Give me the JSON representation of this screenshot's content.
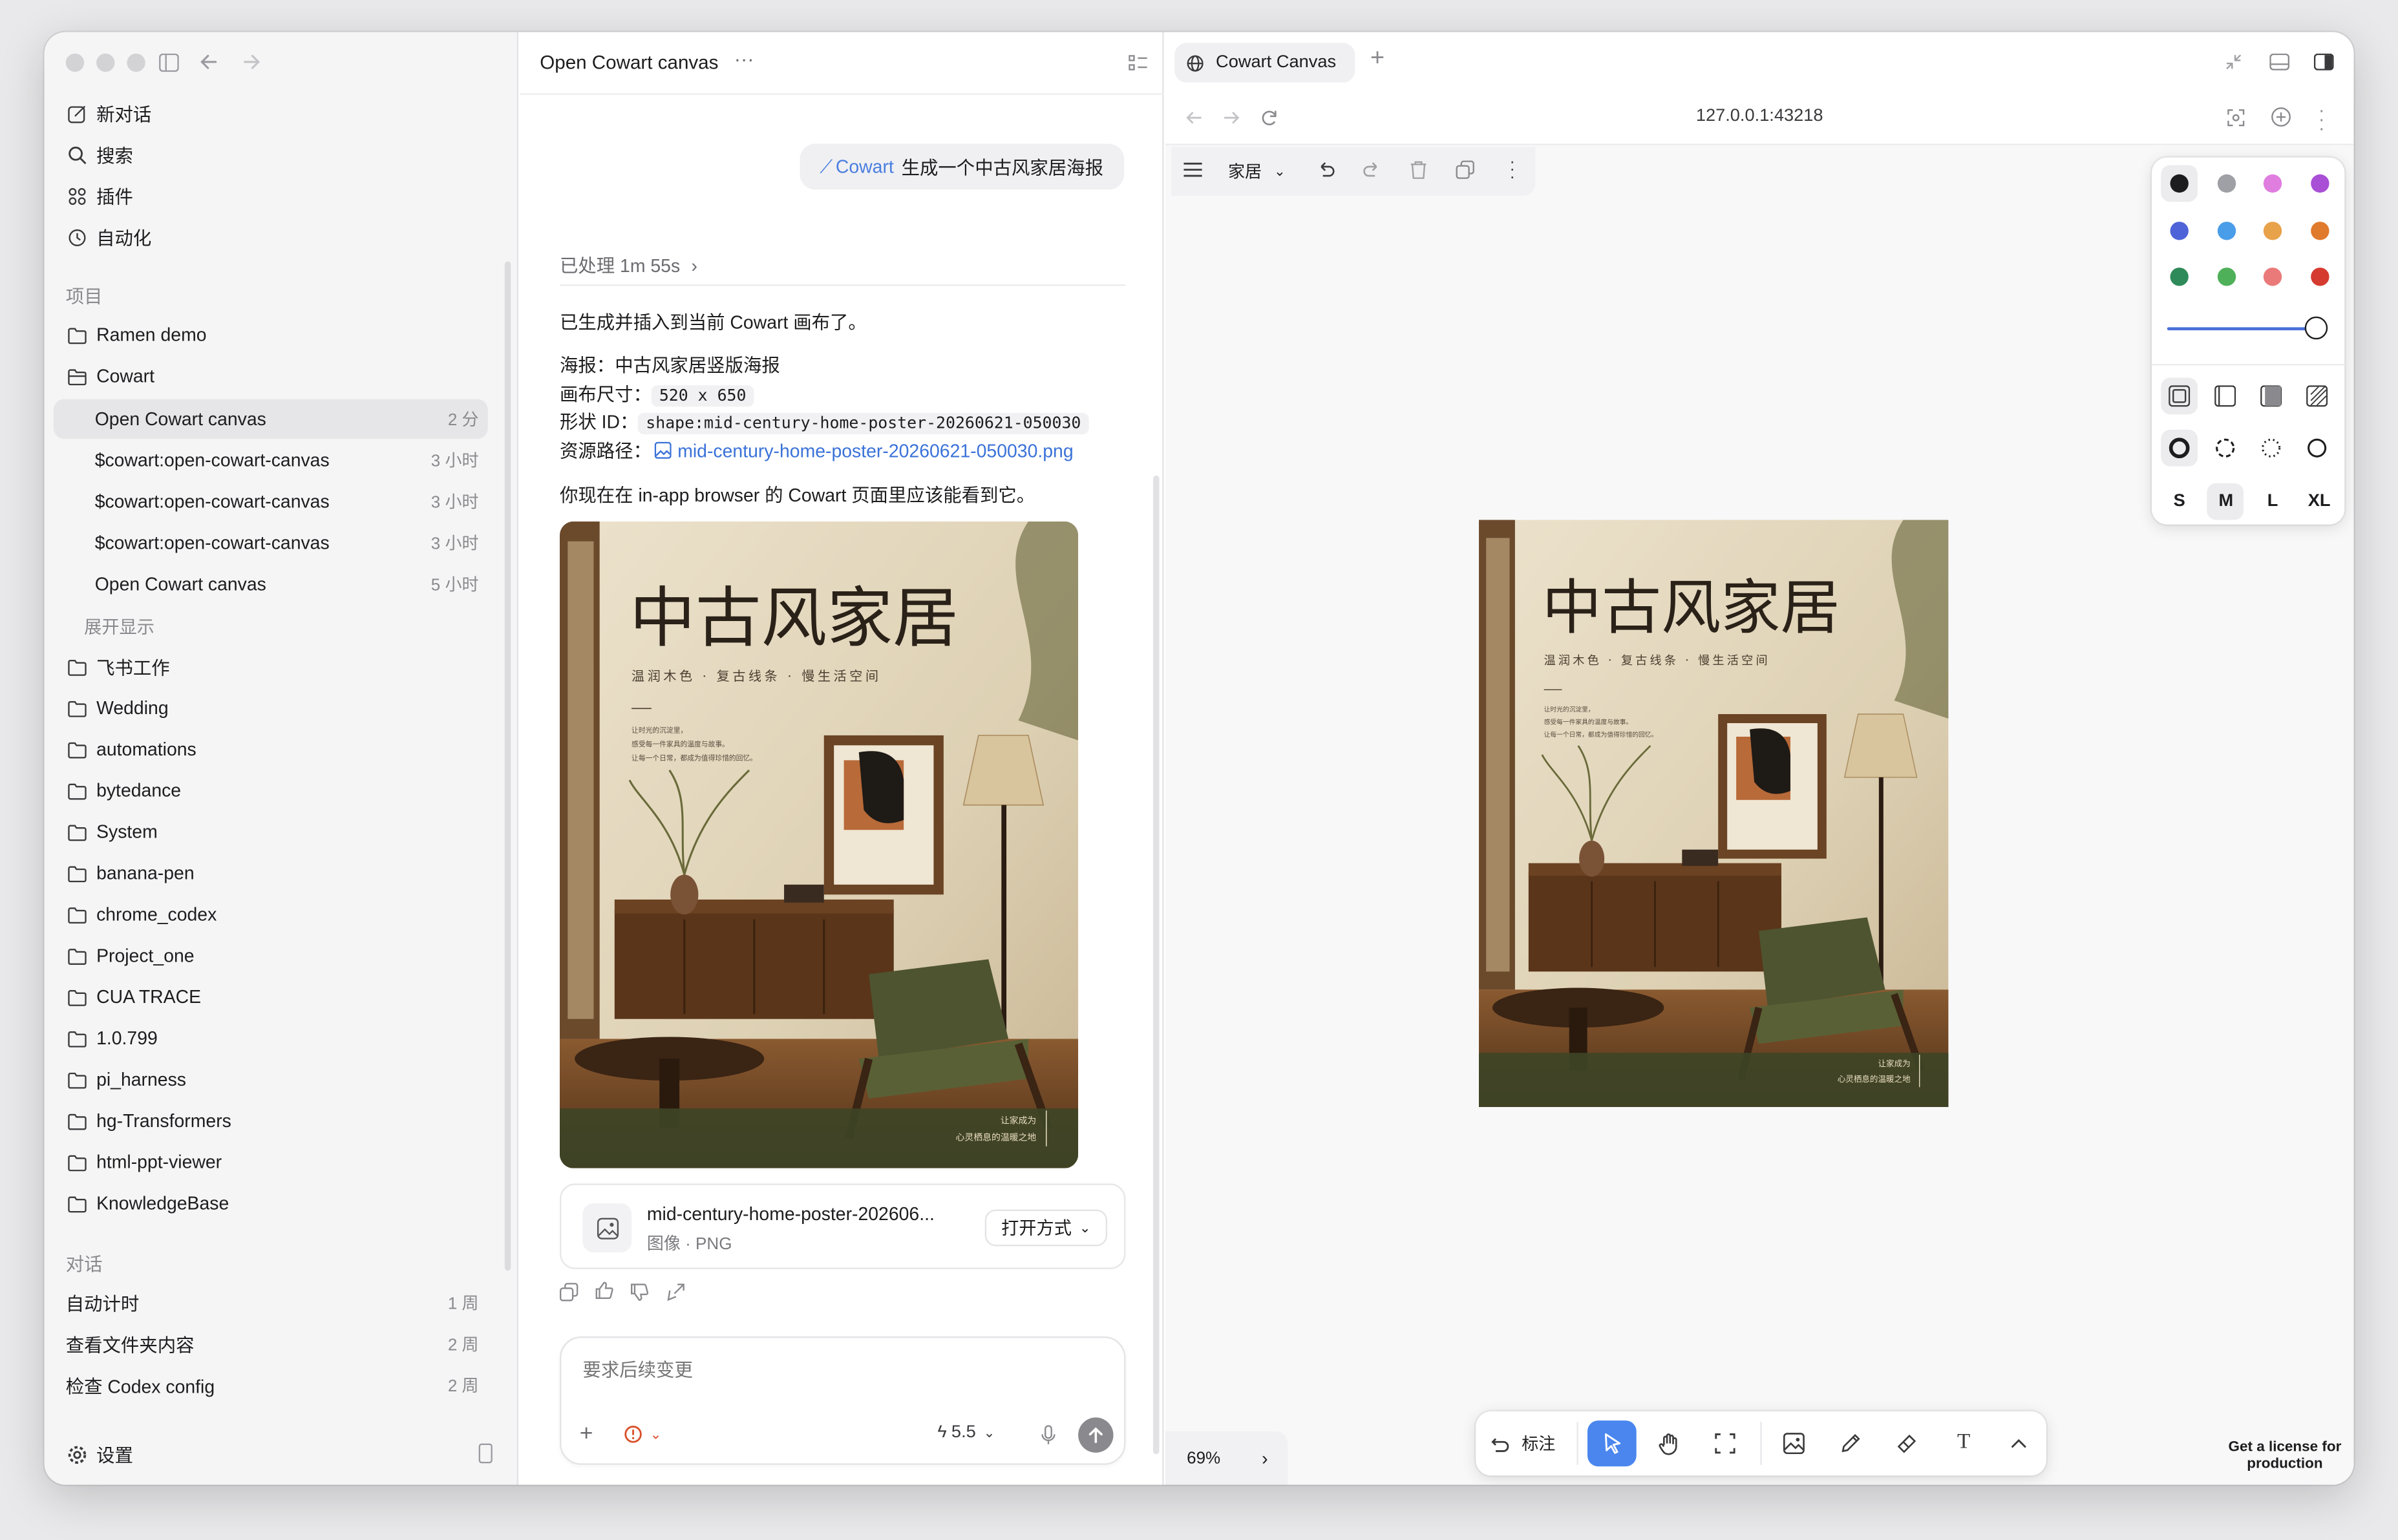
{
  "sidebar": {
    "top_items": [
      {
        "label": "新对话",
        "icon": "new-chat-icon"
      },
      {
        "label": "搜索",
        "icon": "search-icon"
      },
      {
        "label": "插件",
        "icon": "plugin-icon"
      },
      {
        "label": "自动化",
        "icon": "automation-icon"
      }
    ],
    "projects_title": "项目",
    "projects_top": [
      {
        "label": "Ramen demo"
      },
      {
        "label": "Cowart"
      }
    ],
    "cowart_threads": [
      {
        "label": "Open Cowart canvas",
        "time": "2 分"
      },
      {
        "label": "$cowart:open-cowart-canvas",
        "time": "3 小时"
      },
      {
        "label": "$cowart:open-cowart-canvas",
        "time": "3 小时"
      },
      {
        "label": "$cowart:open-cowart-canvas",
        "time": "3 小时"
      },
      {
        "label": "Open Cowart canvas",
        "time": "5 小时"
      }
    ],
    "expand_label": "展开显示",
    "projects_rest": [
      {
        "label": "飞书工作"
      },
      {
        "label": "Wedding"
      },
      {
        "label": "automations"
      },
      {
        "label": "bytedance"
      },
      {
        "label": "System"
      },
      {
        "label": "banana-pen"
      },
      {
        "label": "chrome_codex"
      },
      {
        "label": "Project_one"
      },
      {
        "label": "CUA TRACE"
      },
      {
        "label": "1.0.799"
      },
      {
        "label": "pi_harness"
      },
      {
        "label": "hg-Transformers"
      },
      {
        "label": "html-ppt-viewer"
      },
      {
        "label": "KnowledgeBase"
      }
    ],
    "chats_title": "对话",
    "chats": [
      {
        "label": "自动计时",
        "time": "1 周"
      },
      {
        "label": "查看文件夹内容",
        "time": "2 周"
      },
      {
        "label": "检查 Codex config",
        "time": "2 周"
      }
    ],
    "settings_label": "设置"
  },
  "chat": {
    "title": "Open Cowart canvas",
    "user_msg_tag": "Cowart",
    "user_msg": "生成一个中古风家居海报",
    "processed": "已处理 1m 55s",
    "reply_line1": "已生成并插入到当前 Cowart 画布了。",
    "poster_label": "海报：",
    "poster_value": "中古风家居竖版海报",
    "size_label": "画布尺寸：",
    "size_value": "520 x 650",
    "shape_label": "形状 ID：",
    "shape_value": "shape:mid-century-home-poster-20260621-050030",
    "path_label": "资源路径：",
    "path_value": "mid-century-home-poster-20260621-050030.png",
    "reply_line2": "你现在在 in-app browser 的 Cowart 页面里应该能看到它。",
    "file_name": "mid-century-home-poster-202606...",
    "file_type": "图像 · PNG",
    "open_with": "打开方式",
    "composer_placeholder": "要求后续变更",
    "model": "5.5"
  },
  "poster": {
    "title": "中古风家居",
    "subtitle": "温润木色 · 复古线条 · 慢生活空间",
    "body": [
      "让时光的沉淀里，",
      "感受每一件家具的温度与故事。",
      "让每一个日常，都成为值得珍惜的回忆。"
    ],
    "corner": [
      "让家成为",
      "心灵栖息的温暖之地"
    ]
  },
  "browser": {
    "tab_label": "Cowart Canvas",
    "url": "127.0.0.1:43218",
    "page_menu": "家居",
    "zoom": "69%",
    "annotate_label": "标注",
    "license_line1": "Get a license for",
    "license_line2": "production",
    "sizes": [
      "S",
      "M",
      "L",
      "XL"
    ],
    "selected_size": "M",
    "colors": [
      "#1d1d1f",
      "#9ea0a5",
      "#e07ee0",
      "#a94fd6",
      "#4f63d8",
      "#4a9de8",
      "#e8a24a",
      "#e07a2c",
      "#2f8a5a",
      "#4fb05a",
      "#ea7a7a",
      "#d63b30"
    ],
    "selected_color": "#1d1d1f"
  }
}
